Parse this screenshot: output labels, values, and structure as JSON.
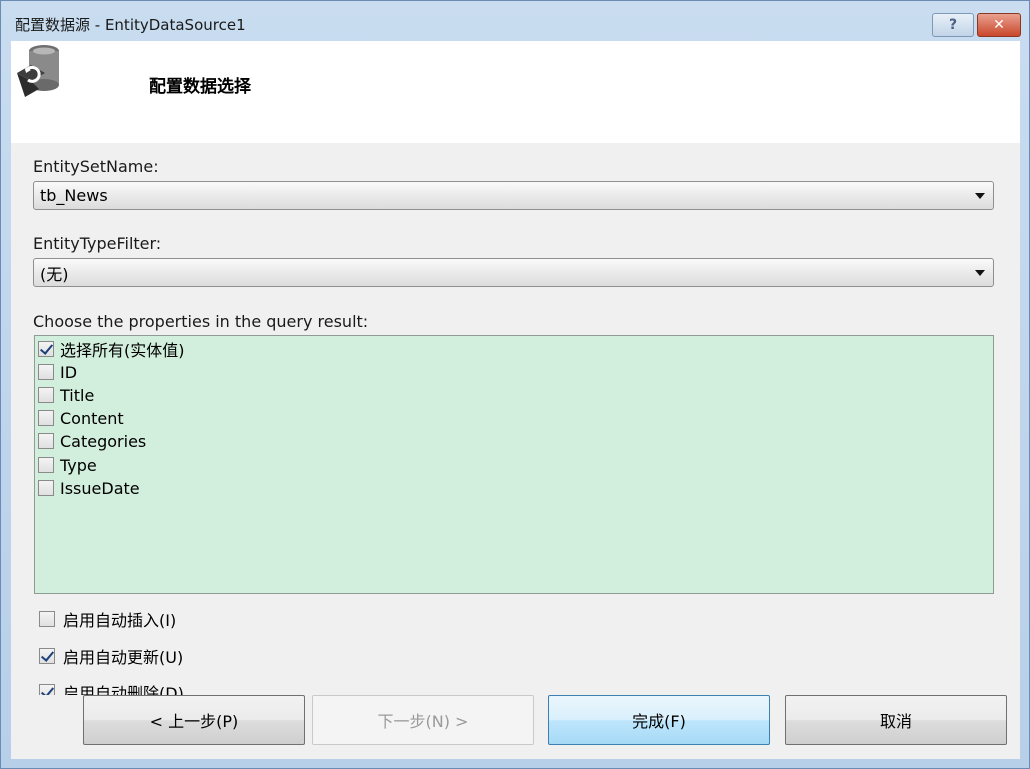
{
  "window": {
    "title": "配置数据源 - EntityDataSource1",
    "help_label": "?",
    "close_label": "✕"
  },
  "header": {
    "title": "配置数据选择",
    "icon": "database-refresh-icon"
  },
  "entity_set": {
    "label": "EntitySetName:",
    "value": "tb_News"
  },
  "entity_type": {
    "label": "EntityTypeFilter:",
    "value": "(无)"
  },
  "properties": {
    "label": "Choose the properties in the query result:",
    "items": [
      {
        "label": "选择所有(实体值)",
        "checked": true
      },
      {
        "label": "ID",
        "checked": false
      },
      {
        "label": "Title",
        "checked": false
      },
      {
        "label": "Content",
        "checked": false
      },
      {
        "label": "Categories",
        "checked": false
      },
      {
        "label": "Type",
        "checked": false
      },
      {
        "label": "IssueDate",
        "checked": false
      }
    ]
  },
  "options": {
    "auto_insert": {
      "label": "启用自动插入(I)",
      "checked": false
    },
    "auto_update": {
      "label": "启用自动更新(U)",
      "checked": true
    },
    "auto_delete": {
      "label": "启用自动删除(D)",
      "checked": true
    }
  },
  "buttons": {
    "previous": "< 上一步(P)",
    "next": "下一步(N) >",
    "finish": "完成(F)",
    "cancel": "取消"
  },
  "colors": {
    "properties_background": "#d2eedc",
    "title_bar": "#c9dcf0",
    "close_button": "#c9472c"
  }
}
